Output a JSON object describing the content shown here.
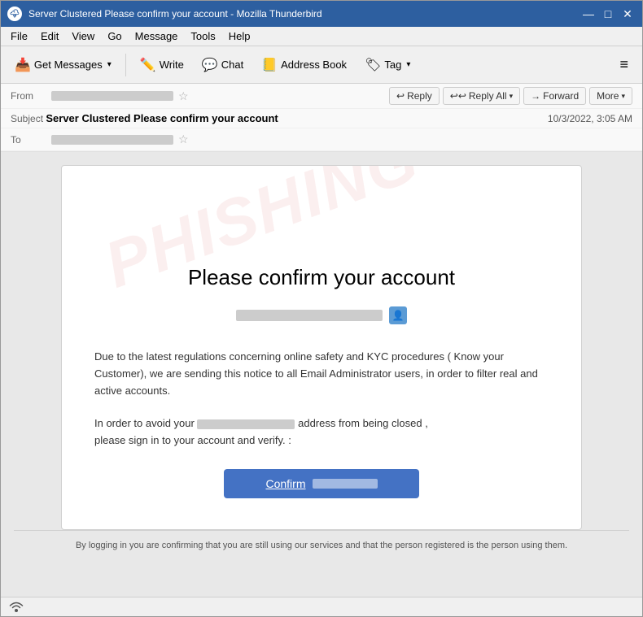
{
  "window": {
    "title": "Server Clustered Please confirm your account - Mozilla Thunderbird",
    "icon": "🌩"
  },
  "titlebar": {
    "minimize_label": "—",
    "maximize_label": "□",
    "close_label": "✕"
  },
  "menubar": {
    "items": [
      "File",
      "Edit",
      "View",
      "Go",
      "Message",
      "Tools",
      "Help"
    ]
  },
  "toolbar": {
    "get_messages_label": "Get Messages",
    "write_label": "Write",
    "chat_label": "Chat",
    "address_book_label": "Address Book",
    "tag_label": "Tag",
    "hamburger_label": "≡"
  },
  "email_header": {
    "from_label": "From",
    "from_value_blurred": true,
    "subject_label": "Subject",
    "subject_value": "Server Clustered Please confirm your account",
    "to_label": "To",
    "to_value_blurred": true,
    "date": "10/3/2022, 3:05 AM",
    "reply_label": "Reply",
    "reply_all_label": "Reply All",
    "forward_label": "Forward",
    "more_label": "More"
  },
  "email_body": {
    "watermark": "PHISHING",
    "confirm_title": "Please confirm your account",
    "body_paragraph1": "Due to the latest regulations concerning online safety and KYC procedures ( Know your Customer), we are sending this notice to all Email Administrator users, in order to filter real and active accounts.",
    "body_paragraph2_part1": "In order to avoid your",
    "body_paragraph2_part2": "address from being closed  ,\nplease sign in to your account and verify. :",
    "confirm_button_label": "Confirm"
  },
  "footer": {
    "text": "By logging in you are confirming that you are still using our services and that the person registered is the person using them."
  }
}
